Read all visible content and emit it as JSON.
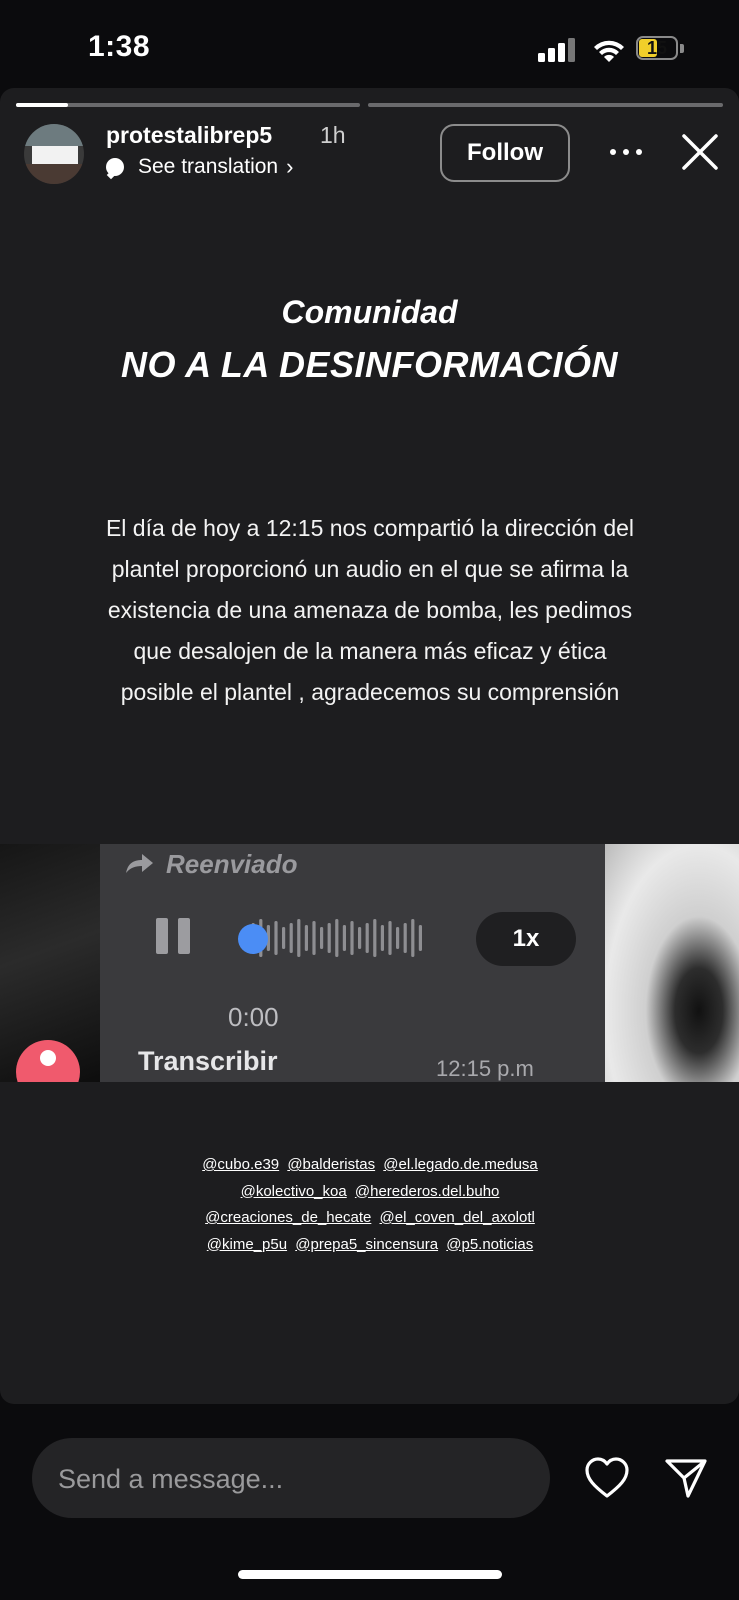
{
  "status_bar": {
    "time": "1:38",
    "battery": "15",
    "signal_icon": "cellular-signal-icon",
    "wifi_icon": "wifi-icon"
  },
  "story": {
    "progress": [
      {
        "fraction": 0.15
      },
      {
        "fraction": 0
      }
    ],
    "username": "protestalibrep5",
    "age": "1h",
    "translate_label": "See translation",
    "follow_label": "Follow",
    "heading1": "Comunidad",
    "heading2": "NO A LA DESINFORMACIÓN",
    "body_lines": [
      "El día de hoy a 12:15 nos compartió la  dirección del",
      "plantel proporcionó un audio en el que se afirma la",
      "existencia de  una amenaza de bomba, les pedimos",
      "que desalojen de la manera más eficaz y ética",
      "posible  el plantel , agradecemos su comprensión"
    ],
    "audio": {
      "forwarded_label": "Reenviado",
      "playback_progress": 0,
      "speed": "1x",
      "duration": "0:00",
      "transcribe_label": "Transcribir",
      "message_time": "12:15 p.m"
    },
    "mentions": [
      [
        "@cubo.e39",
        "@balderistas",
        "@el.legado.de.medusa"
      ],
      [
        "@kolectivo_koa",
        "@herederos.del.buho"
      ],
      [
        "@creaciones_de_hecate",
        "@el_coven_del_axolotl"
      ],
      [
        "@kime_p5u",
        "@prepa5_sincensura",
        "@p5.noticias"
      ]
    ]
  },
  "bottom_bar": {
    "message_placeholder": "Send a message...",
    "like_icon": "heart-icon",
    "send_icon": "send-icon"
  }
}
